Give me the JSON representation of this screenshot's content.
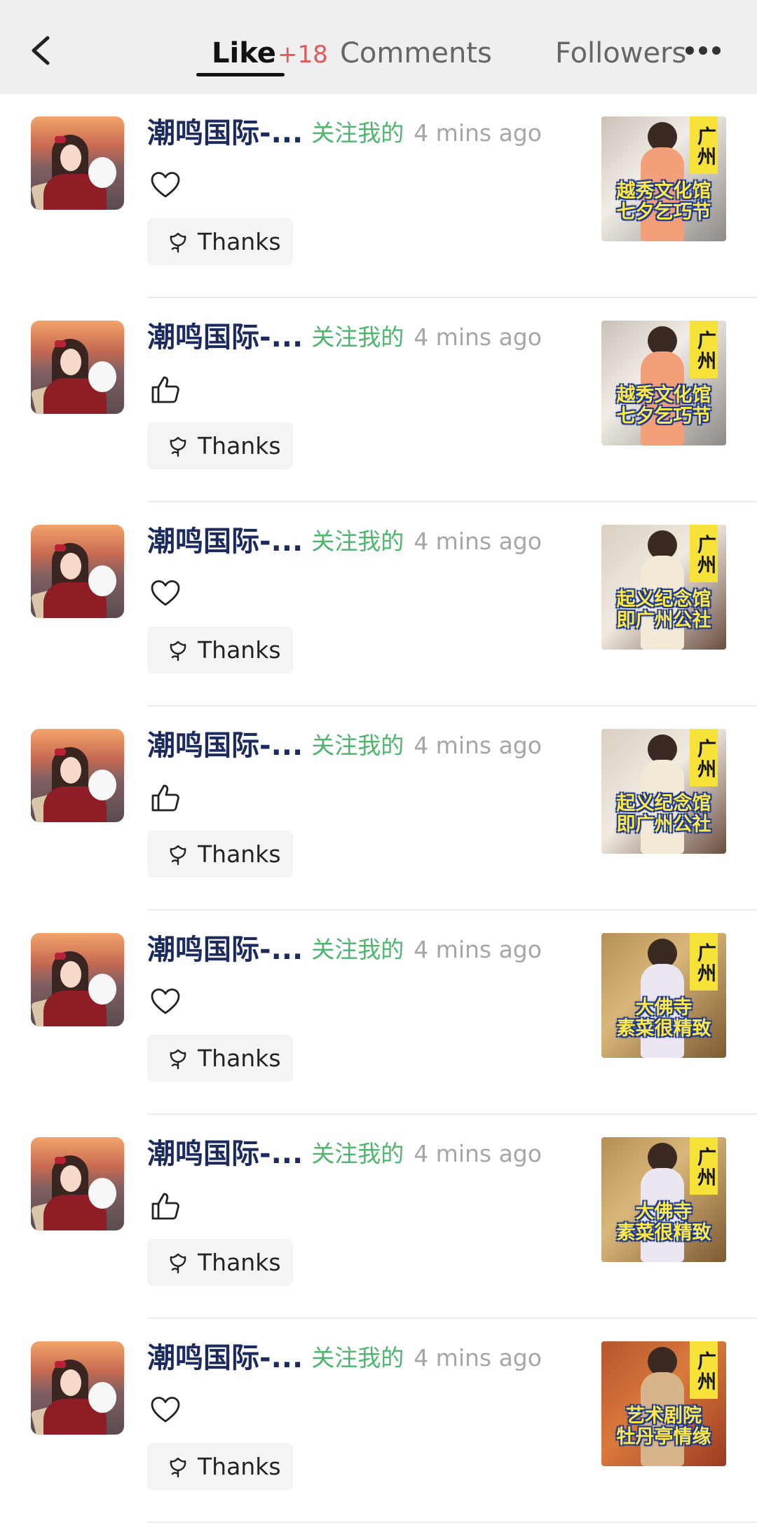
{
  "header": {
    "tabs": [
      {
        "label": "Like",
        "count": "+18",
        "active": true
      },
      {
        "label": "Comments"
      },
      {
        "label": "Followers"
      }
    ],
    "back_icon": "chevron-left-icon",
    "more_icon": "more-dots-icon"
  },
  "colors": {
    "username": "#1c2a5e",
    "follow_tag": "#4cb66c",
    "like_count": "#e05a5a",
    "thumb_tag_bg": "#f7e23a",
    "thumb_caption": "#ffe84a"
  },
  "notifications": [
    {
      "username": "潮鸣国际-...",
      "tag": "关注我的",
      "time": "4 mins ago",
      "reaction": "heart-icon",
      "thanks_label": "Thanks",
      "thumb": {
        "tag": "广州",
        "caption_lines": [
          "越秀文化馆",
          "七夕乞巧节"
        ],
        "theme": "orange"
      }
    },
    {
      "username": "潮鸣国际-...",
      "tag": "关注我的",
      "time": "4 mins ago",
      "reaction": "thumbs-up-icon",
      "thanks_label": "Thanks",
      "thumb": {
        "tag": "广州",
        "caption_lines": [
          "越秀文化馆",
          "七夕乞巧节"
        ],
        "theme": "orange"
      }
    },
    {
      "username": "潮鸣国际-...",
      "tag": "关注我的",
      "time": "4 mins ago",
      "reaction": "heart-icon",
      "thanks_label": "Thanks",
      "thumb": {
        "tag": "广州",
        "caption_lines": [
          "起义纪念馆",
          "即广州公社"
        ],
        "theme": "cream"
      }
    },
    {
      "username": "潮鸣国际-...",
      "tag": "关注我的",
      "time": "4 mins ago",
      "reaction": "thumbs-up-icon",
      "thanks_label": "Thanks",
      "thumb": {
        "tag": "广州",
        "caption_lines": [
          "起义纪念馆",
          "即广州公社"
        ],
        "theme": "cream"
      }
    },
    {
      "username": "潮鸣国际-...",
      "tag": "关注我的",
      "time": "4 mins ago",
      "reaction": "heart-icon",
      "thanks_label": "Thanks",
      "thumb": {
        "tag": "广州",
        "caption_lines": [
          "大佛寺",
          "素菜很精致"
        ],
        "theme": "temple"
      }
    },
    {
      "username": "潮鸣国际-...",
      "tag": "关注我的",
      "time": "4 mins ago",
      "reaction": "thumbs-up-icon",
      "thanks_label": "Thanks",
      "thumb": {
        "tag": "广州",
        "caption_lines": [
          "大佛寺",
          "素菜很精致"
        ],
        "theme": "temple"
      }
    },
    {
      "username": "潮鸣国际-...",
      "tag": "关注我的",
      "time": "4 mins ago",
      "reaction": "heart-icon",
      "thanks_label": "Thanks",
      "thumb": {
        "tag": "广州",
        "caption_lines": [
          "艺术剧院",
          "牡丹亭情缘"
        ],
        "theme": "theatre"
      }
    }
  ]
}
